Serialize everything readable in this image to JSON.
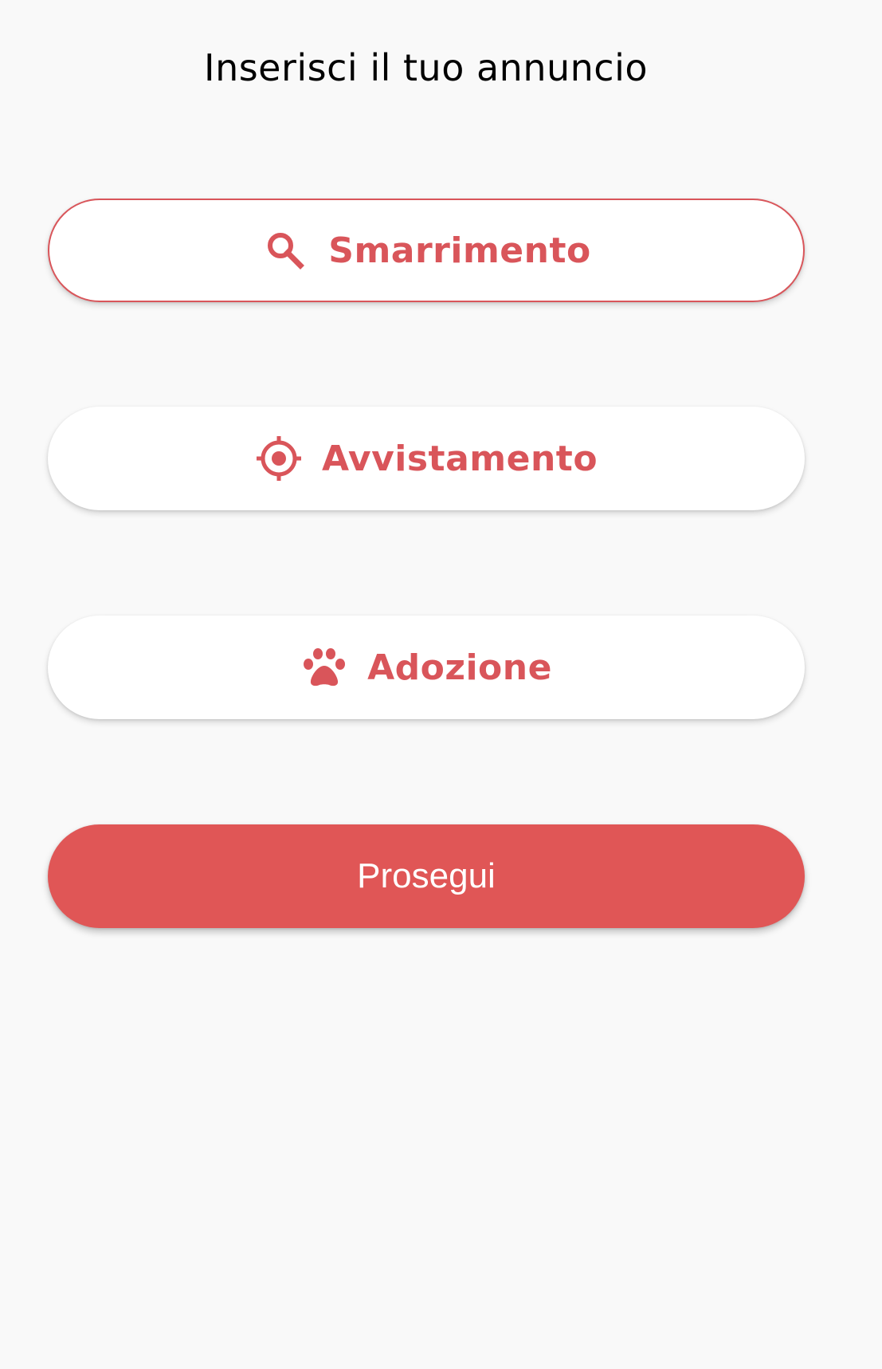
{
  "header": {
    "title": "Inserisci il tuo annuncio"
  },
  "options": [
    {
      "label": "Smarrimento",
      "icon": "search-icon",
      "selected": true
    },
    {
      "label": "Avvistamento",
      "icon": "target-icon",
      "selected": false
    },
    {
      "label": "Adozione",
      "icon": "paw-icon",
      "selected": false
    }
  ],
  "actions": {
    "continue_label": "Prosegui"
  },
  "colors": {
    "accent": "#d9555a",
    "primary_button": "#e05656",
    "background": "#f9f9f9",
    "card": "#ffffff"
  }
}
